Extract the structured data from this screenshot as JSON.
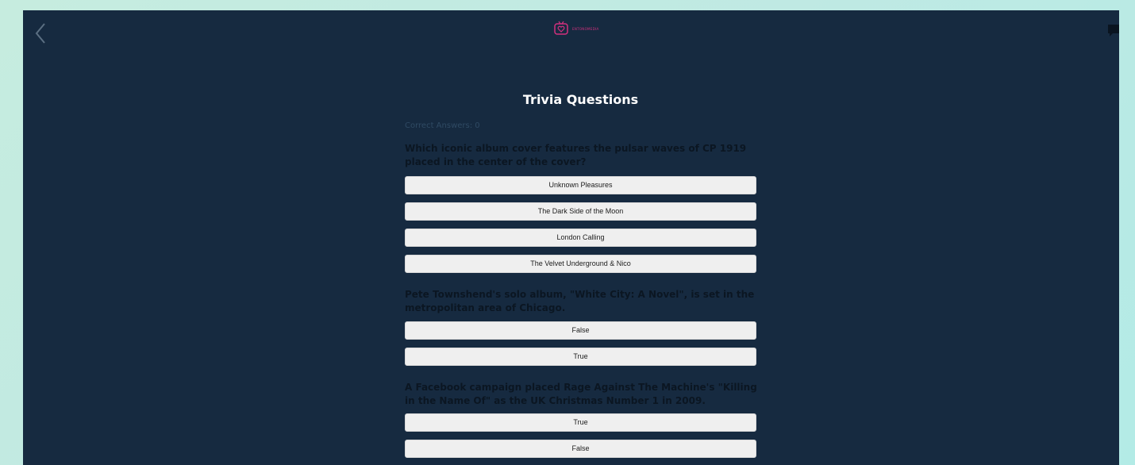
{
  "header": {
    "back_icon": "chevron-left-icon",
    "logo_text": "ENTONOMEDIA",
    "menu_icon": "chat-icon",
    "brand_color": "#d2307e"
  },
  "main": {
    "title": "Trivia Questions",
    "score_text": "Correct Answers: 0"
  },
  "questions": [
    {
      "text": "Which iconic album cover features the pulsar waves of CP 1919 placed in the center of the cover?",
      "answers": [
        "Unknown Pleasures",
        "The Dark Side of the Moon",
        "London Calling",
        "The Velvet Underground & Nico"
      ]
    },
    {
      "text": "Pete Townshend's solo album, \"White City: A Novel\", is set in the metropolitan area of Chicago.",
      "answers": [
        "False",
        "True"
      ]
    },
    {
      "text": "A Facebook campaign placed Rage Against The Machine's \"Killing in the Name Of\" as the UK Christmas Number 1 in 2009.",
      "answers": [
        "True",
        "False"
      ]
    }
  ],
  "colors": {
    "app_background": "#162a40",
    "button_background": "#efefef",
    "question_text": "#0b1622",
    "title_text": "#ffffff"
  }
}
